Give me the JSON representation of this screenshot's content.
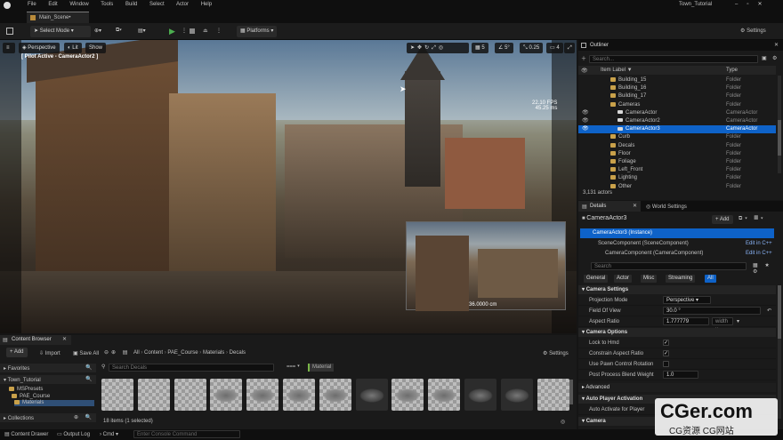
{
  "app": {
    "menu": [
      "File",
      "Edit",
      "Window",
      "Tools",
      "Build",
      "Select",
      "Actor",
      "Help"
    ],
    "project_name": "Town_Tutorial",
    "tab": "Main_Scene•"
  },
  "toolbar": {
    "select_mode": "Select Mode",
    "platforms": "Platforms",
    "settings": "Settings"
  },
  "viewport": {
    "perspective": "Perspective",
    "lit": "Lit",
    "show": "Show",
    "pilot_label": "[ Pilot Active - CameraActor2 ]",
    "grid_snap": "5",
    "rotation_snap": "5°",
    "scale_snap": "0.25",
    "camera_speed": "4",
    "fps_text": "22.10 FPS",
    "fps_ms": "45.25 ms",
    "preview_distance": "36.0000 cm"
  },
  "outliner": {
    "title": "Outliner",
    "search_placeholder": "Search...",
    "col_label": "Item Label ▼",
    "col_type": "Type",
    "rows": [
      {
        "label": "Building_15",
        "type": "Folder",
        "kind": "folder",
        "indent": 1
      },
      {
        "label": "Building_16",
        "type": "Folder",
        "kind": "folder",
        "indent": 1
      },
      {
        "label": "Building_17",
        "type": "Folder",
        "kind": "folder",
        "indent": 1
      },
      {
        "label": "Cameras",
        "type": "Folder",
        "kind": "folder",
        "indent": 1
      },
      {
        "label": "CameraActor",
        "type": "CameraActor",
        "kind": "cam",
        "indent": 2
      },
      {
        "label": "CameraActor2",
        "type": "CameraActor",
        "kind": "cam",
        "indent": 2
      },
      {
        "label": "CameraActor3",
        "type": "CameraActor",
        "kind": "cam",
        "indent": 2,
        "selected": true
      },
      {
        "label": "Curb",
        "type": "Folder",
        "kind": "folder",
        "indent": 1
      },
      {
        "label": "Decals",
        "type": "Folder",
        "kind": "folder",
        "indent": 1
      },
      {
        "label": "Floor",
        "type": "Folder",
        "kind": "folder",
        "indent": 1
      },
      {
        "label": "Foliage",
        "type": "Folder",
        "kind": "folder",
        "indent": 1
      },
      {
        "label": "Left_Front",
        "type": "Folder",
        "kind": "folder",
        "indent": 1
      },
      {
        "label": "Lighting",
        "type": "Folder",
        "kind": "folder",
        "indent": 1
      },
      {
        "label": "Other",
        "type": "Folder",
        "kind": "folder",
        "indent": 1
      }
    ],
    "count": "3,131 actors"
  },
  "details": {
    "tab_details": "Details",
    "tab_world": "World Settings",
    "actor_name": "CameraActor3",
    "add_label": "+ Add",
    "instance": "CameraActor3 (Instance)",
    "components": [
      {
        "label": "SceneComponent (SceneComponent)",
        "link": "Edit in C++"
      },
      {
        "label": "CameraComponent (CameraComponent)",
        "link": "Edit in C++"
      }
    ],
    "search_placeholder": "Search",
    "filters": [
      "General",
      "Actor",
      "Misc",
      "Streaming",
      "All"
    ],
    "camera_settings": "Camera Settings",
    "projection_mode_label": "Projection Mode",
    "projection_mode_value": "Perspective",
    "fov_label": "Field Of View",
    "fov_value": "30.0 °",
    "aspect_label": "Aspect Ratio",
    "aspect_value": "1.777779",
    "aspect_preset": "width x",
    "camera_options": "Camera Options",
    "lock_hmd": "Lock to Hmd",
    "constrain_aspect": "Constrain Aspect Ratio",
    "use_pawn": "Use Pawn Control Rotation",
    "blend_weight_label": "Post Process Blend Weight",
    "blend_weight_value": "1.0",
    "advanced": "Advanced",
    "auto_player": "Auto Player Activation",
    "auto_activate": "Auto Activate for Player",
    "camera": "Camera"
  },
  "content": {
    "tab": "Content Browser",
    "add": "+ Add",
    "import": "Import",
    "save_all": "Save All",
    "path": [
      "All",
      "Content",
      "PAE_Course",
      "Materials",
      "Decals"
    ],
    "settings": "Settings",
    "favorites": "Favorites",
    "root": "Town_Tutorial",
    "tree": [
      "MSPresets",
      "PAE_Course",
      "Materials"
    ],
    "collections": "Collections",
    "search_placeholder": "Search Decals",
    "filter_chip": "Material",
    "item_count": "18 items (1 selected)"
  },
  "status": {
    "content_drawer": "Content Drawer",
    "output_log": "Output Log",
    "cmd": "Cmd ▾",
    "console_placeholder": "Enter Console Command"
  },
  "watermark": {
    "domain": "CGer.com",
    "sub": "CG资源 CG网站"
  },
  "colors": {
    "selection": "#0e62c8",
    "play": "#4caf50",
    "folder": "#c9a14a"
  }
}
